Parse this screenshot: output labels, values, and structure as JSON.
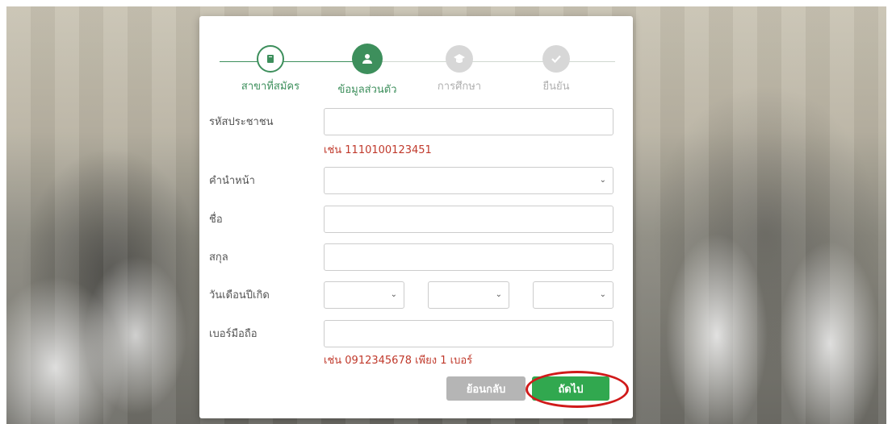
{
  "steps": [
    {
      "label": "สาขาที่สมัคร",
      "icon": "book-icon",
      "state": "done"
    },
    {
      "label": "ข้อมูลส่วนตัว",
      "icon": "user-icon",
      "state": "active"
    },
    {
      "label": "การศึกษา",
      "icon": "graduation-cap-icon",
      "state": "pending"
    },
    {
      "label": "ยืนยัน",
      "icon": "check-icon",
      "state": "pending"
    }
  ],
  "form": {
    "citizen_id_label": "รหัสประชาชน",
    "citizen_id_value": "",
    "citizen_id_hint": "เช่น 1110100123451",
    "title_label": "คำนำหน้า",
    "title_value": "",
    "first_name_label": "ชื่อ",
    "first_name_value": "",
    "last_name_label": "สกุล",
    "last_name_value": "",
    "birthdate_label": "วันเดือนปีเกิด",
    "day_value": "",
    "month_value": "",
    "year_value": "",
    "phone_label": "เบอร์มือถือ",
    "phone_value": "",
    "phone_hint": "เช่น 0912345678 เพียง 1 เบอร์"
  },
  "buttons": {
    "back_label": "ย้อนกลับ",
    "next_label": "ถัดไป"
  },
  "colors": {
    "primary": "#3d8f5c",
    "next_button": "#31a84f",
    "back_button": "#b5b5b5",
    "hint": "#c0392b",
    "highlight": "#d01a1a"
  }
}
